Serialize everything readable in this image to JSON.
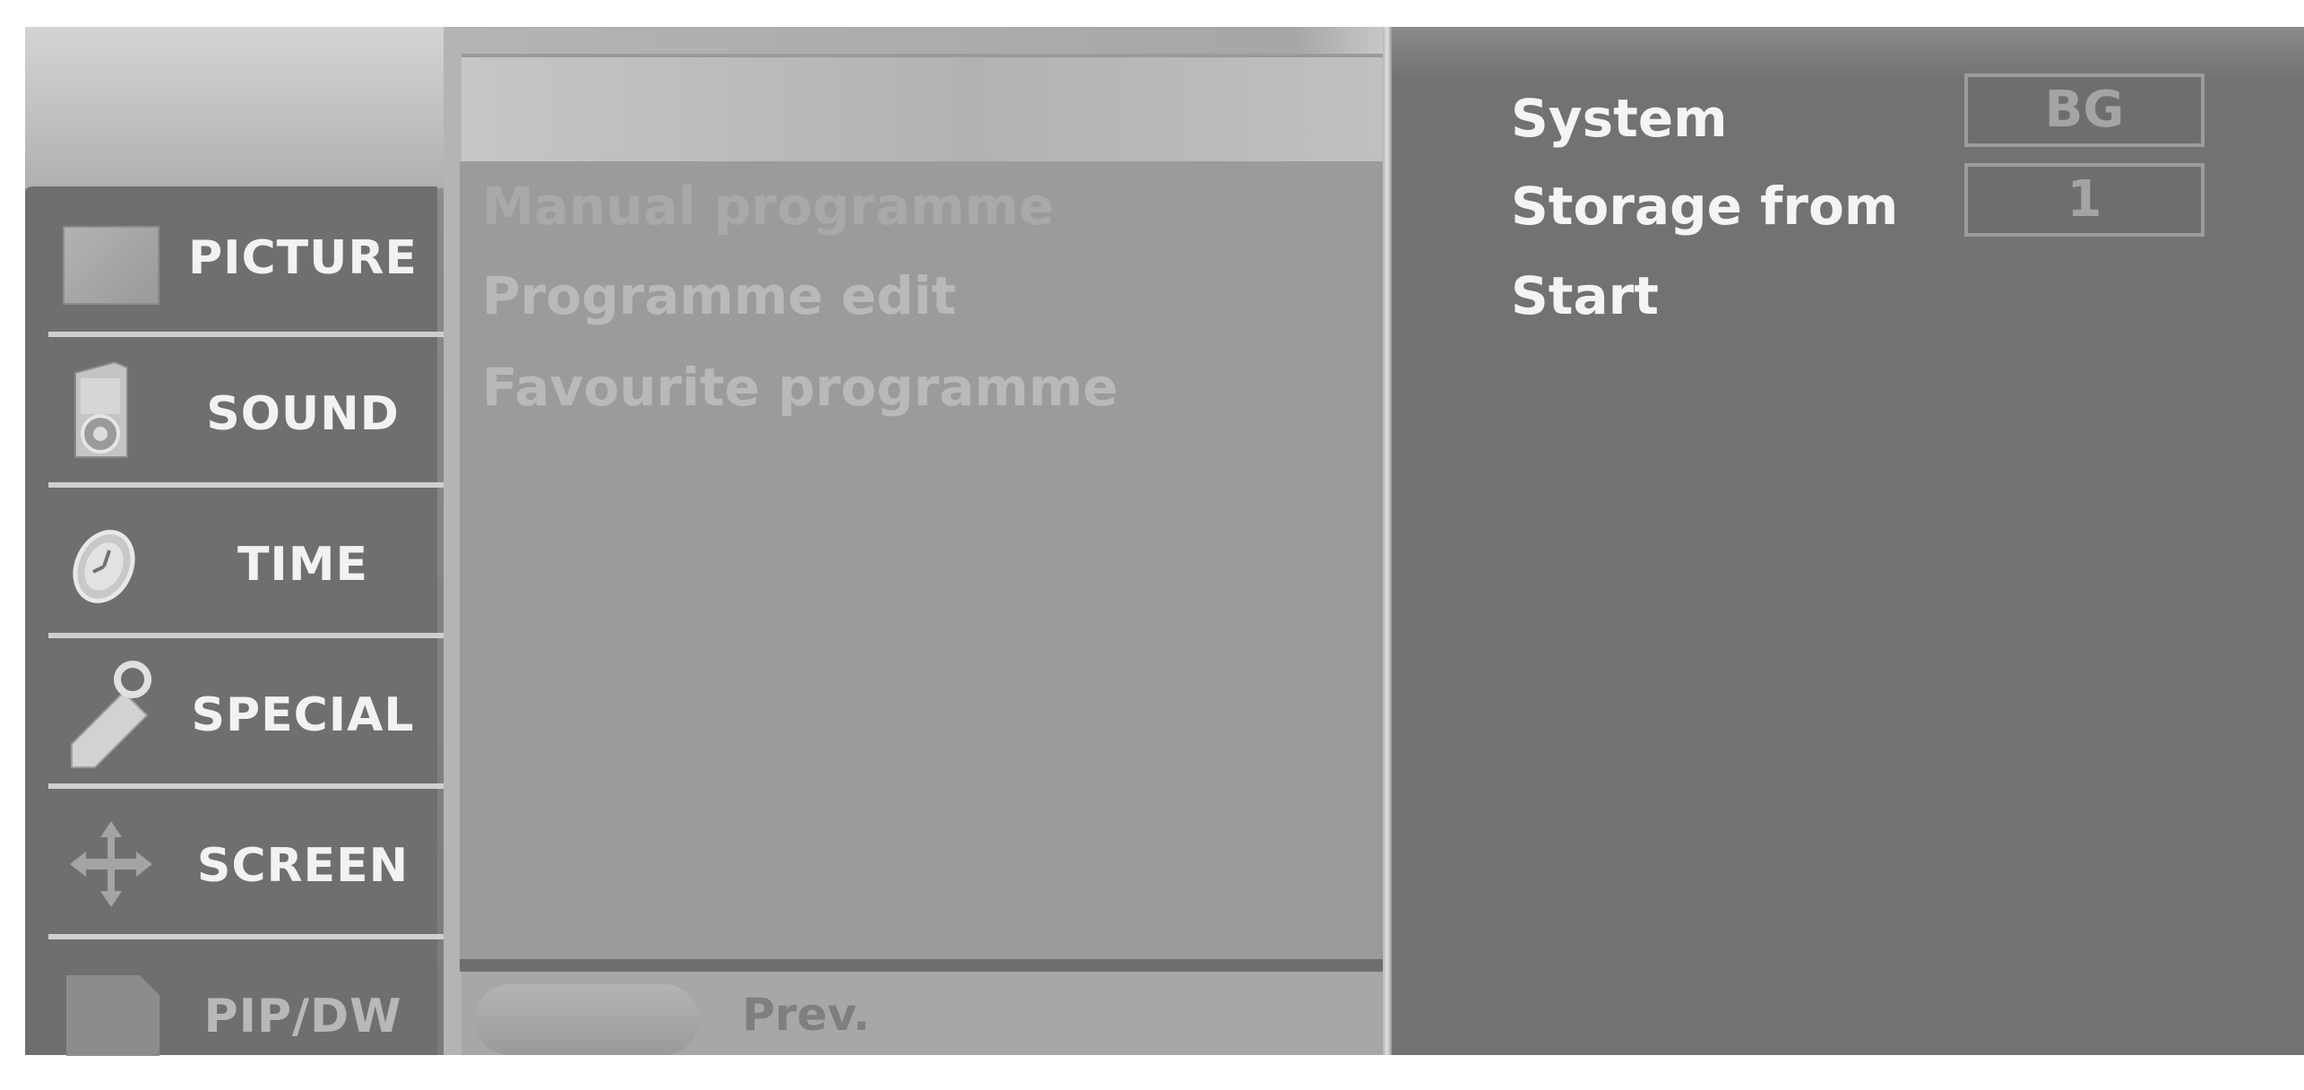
{
  "categories": [
    {
      "label": "PICTURE",
      "icon": "picture-icon"
    },
    {
      "label": "SOUND",
      "icon": "speaker-icon"
    },
    {
      "label": "TIME",
      "icon": "clock-icon"
    },
    {
      "label": "SPECIAL",
      "icon": "key-tag-icon"
    },
    {
      "label": "SCREEN",
      "icon": "move-arrows-icon"
    },
    {
      "label": "PIP/DW",
      "icon": "pip-icon"
    }
  ],
  "menu": {
    "items": [
      {
        "label": "Manual programme"
      },
      {
        "label": "Programme edit"
      },
      {
        "label": "Favourite programme"
      }
    ],
    "prev_label": "Prev."
  },
  "settings": {
    "system": {
      "label": "System",
      "value": "BG"
    },
    "storage": {
      "label": "Storage from",
      "value": "1"
    },
    "start": {
      "label": "Start"
    }
  }
}
